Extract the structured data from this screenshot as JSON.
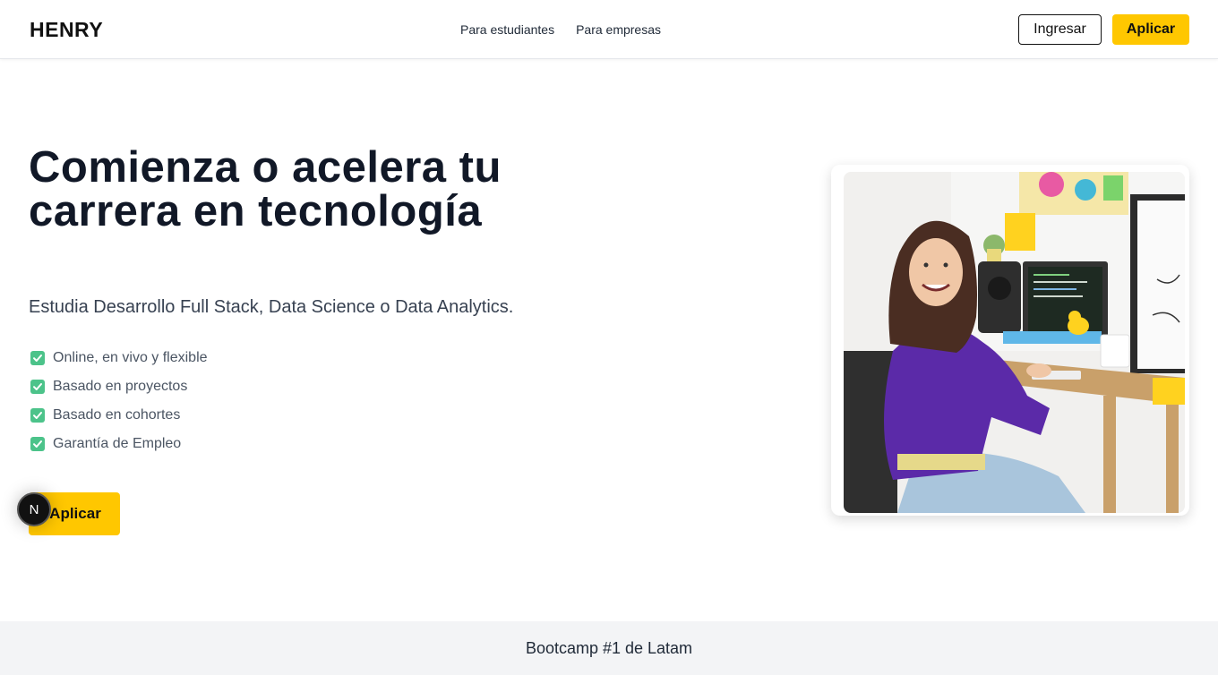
{
  "header": {
    "logo": "HENRY",
    "nav": [
      {
        "label": "Para estudiantes"
      },
      {
        "label": "Para empresas"
      }
    ],
    "login_label": "Ingresar",
    "apply_label": "Aplicar"
  },
  "hero": {
    "title": "Comienza o acelera tu carrera en tecnología",
    "subtitle": "Estudia Desarrollo Full Stack, Data Science o Data Analytics.",
    "features": [
      {
        "label": "Online, en vivo y flexible"
      },
      {
        "label": "Basado en proyectos"
      },
      {
        "label": "Basado en cohortes"
      },
      {
        "label": "Garantía de Empleo"
      }
    ],
    "apply_label": "Aplicar",
    "badge": "N"
  },
  "banner": {
    "text": "Bootcamp #1 de Latam"
  },
  "colors": {
    "accent": "#ffc700",
    "check": "#4cc38a",
    "sweater": "#5b2aa8"
  },
  "icons": [
    "check-icon",
    "hero-photo"
  ]
}
